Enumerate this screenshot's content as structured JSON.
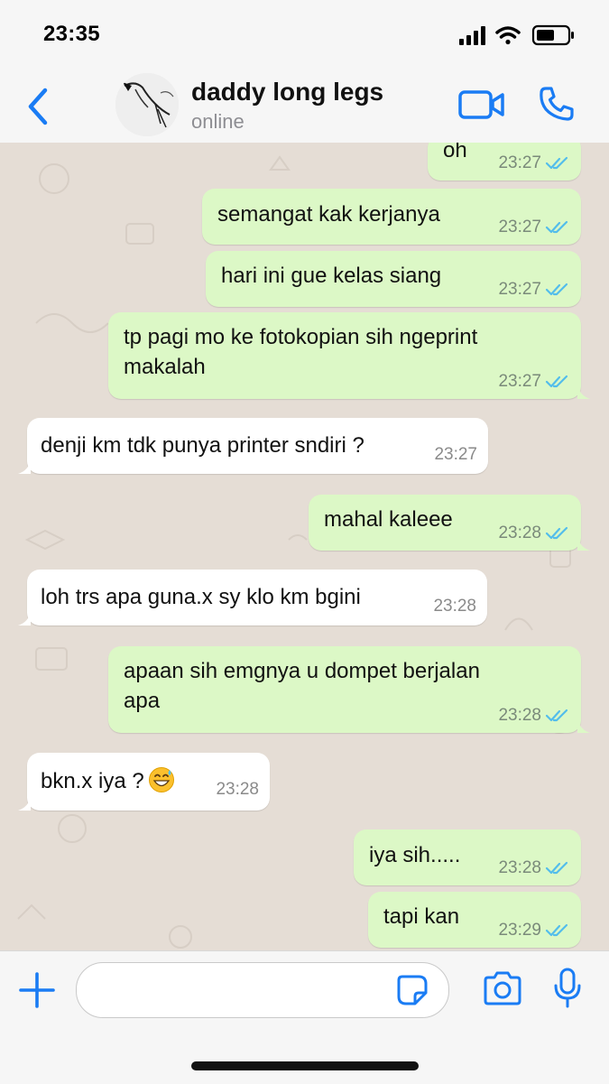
{
  "status_bar": {
    "time": "23:35"
  },
  "header": {
    "back_icon": "chevron-left-icon",
    "name": "daddy long legs",
    "status": "online",
    "video_icon": "video-call-icon",
    "phone_icon": "phone-icon"
  },
  "messages": [
    {
      "dir": "out",
      "lines": [
        "oh"
      ],
      "time": "23:27",
      "read": true
    },
    {
      "dir": "out",
      "lines": [
        "semangat kak kerjanya"
      ],
      "time": "23:27",
      "read": true
    },
    {
      "dir": "out",
      "lines": [
        "hari ini gue kelas siang"
      ],
      "time": "23:27",
      "read": true
    },
    {
      "dir": "out",
      "lines": [
        "tp pagi mo ke fotokopian sih ngeprint",
        "makalah"
      ],
      "time": "23:27",
      "read": true
    },
    {
      "dir": "in",
      "lines": [
        "denji km tdk punya printer sndiri ?"
      ],
      "time": "23:27"
    },
    {
      "dir": "out",
      "lines": [
        "mahal kaleee"
      ],
      "time": "23:28",
      "read": true
    },
    {
      "dir": "in",
      "lines": [
        "loh trs apa guna.x sy klo km bgini"
      ],
      "time": "23:28"
    },
    {
      "dir": "out",
      "lines": [
        "apaan sih emgnya u dompet berjalan",
        "apa"
      ],
      "time": "23:28",
      "read": true
    },
    {
      "dir": "in",
      "lines": [
        "bkn.x iya ?"
      ],
      "emoji": "grinning-sweat-emoji",
      "time": "23:28"
    },
    {
      "dir": "out",
      "lines": [
        "iya sih....."
      ],
      "time": "23:28",
      "read": true
    },
    {
      "dir": "out",
      "lines": [
        "tapi kan"
      ],
      "time": "23:29",
      "read": true
    }
  ],
  "composer": {
    "input_value": "",
    "plus_icon": "plus-icon",
    "sticker_icon": "sticker-icon",
    "camera_icon": "camera-icon",
    "mic_icon": "microphone-icon"
  },
  "colors": {
    "accent": "#1a7cf4",
    "outgoing": "#dcf8c6",
    "incoming": "#ffffff",
    "chat_bg": "#e5ddd5",
    "read_ticks": "#53bdeb"
  }
}
